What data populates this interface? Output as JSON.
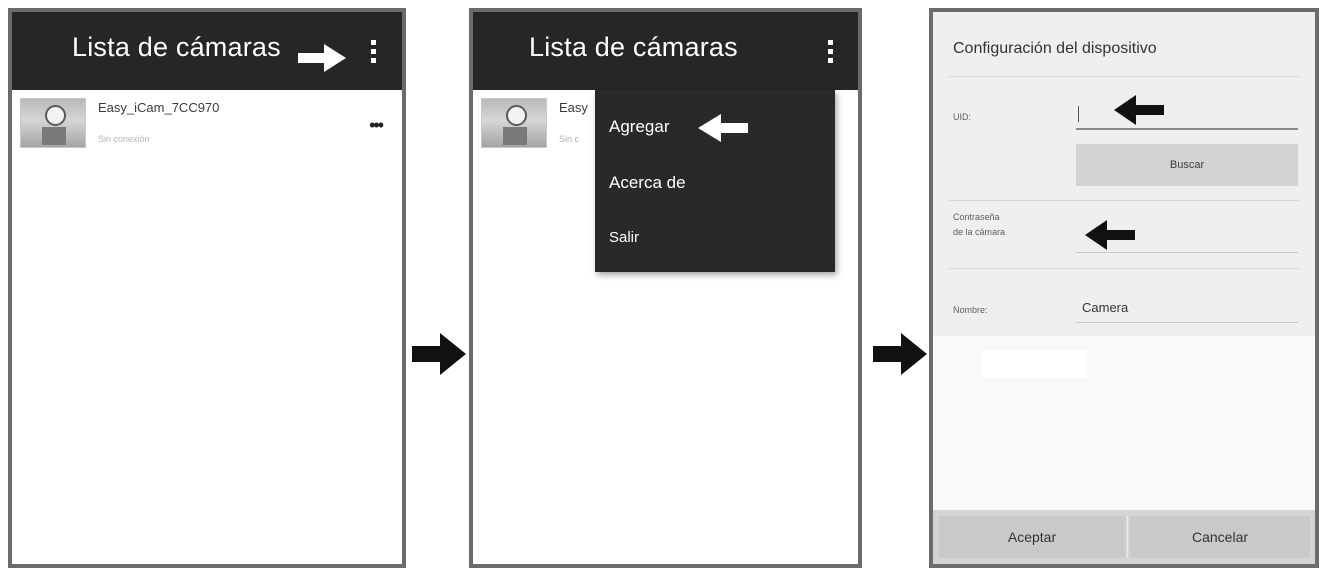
{
  "screen1": {
    "title": "Lista de cámaras",
    "camera_item": {
      "name": "Easy_iCam_7CC970",
      "status": "Sin conexión",
      "more_glyph": "•••"
    }
  },
  "screen2": {
    "title": "Lista de cámaras",
    "item_name_partial": "Easy",
    "item_status_partial": "Sin c",
    "menu": {
      "items": [
        "Agregar",
        "Acerca de",
        "Salir"
      ]
    }
  },
  "screen3": {
    "title": "Configuración del dispositivo",
    "uid_label": "UID:",
    "uid_value": "",
    "search_label": "Buscar",
    "password_label_line1": "Contraseña",
    "password_label_line2": "de la cámara",
    "name_label": "Nombre:",
    "name_value": "Camera",
    "accept_label": "Aceptar",
    "cancel_label": "Cancelar"
  },
  "icons": {
    "overflow": "overflow-menu-icon",
    "white_arrow": "arrow-right-white",
    "black_arrow": "arrow-right-black",
    "left_arrow": "arrow-left"
  },
  "colors": {
    "appbar": "#262626",
    "menu": "#292929",
    "dialog_bg": "#efefef",
    "frame": "#6b6b6b"
  }
}
